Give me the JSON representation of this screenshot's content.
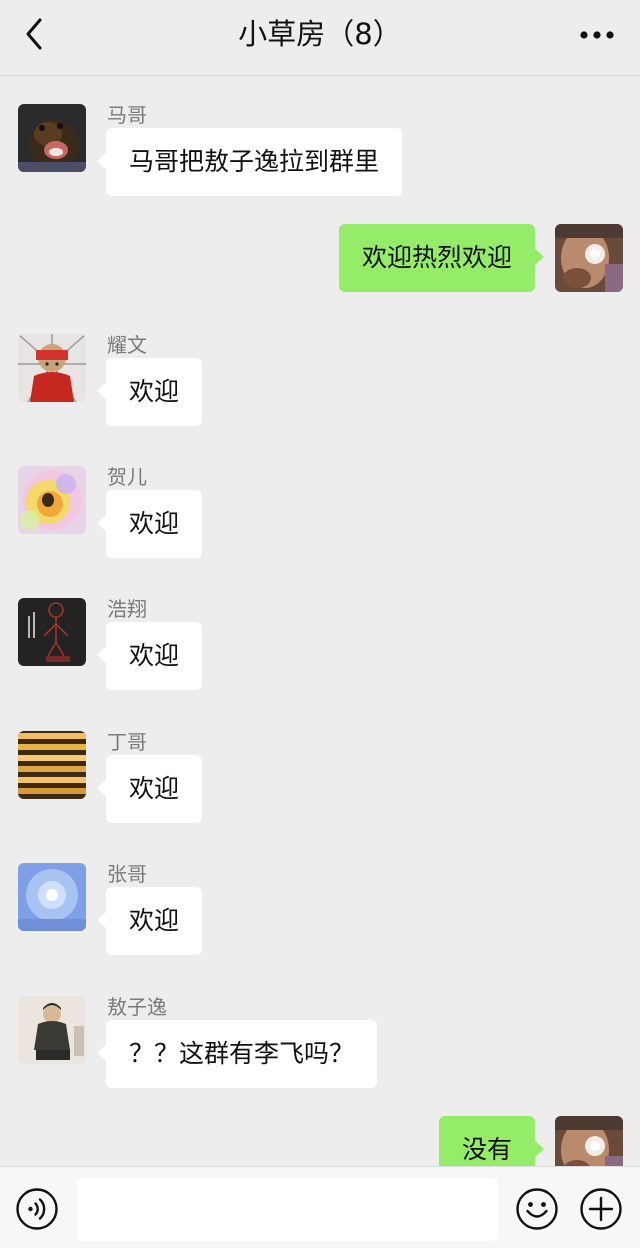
{
  "header": {
    "title": "小草房（8）",
    "back_icon": "chevron-left-icon",
    "more_icon": "more-horizontal-icon"
  },
  "messages": [
    {
      "side": "left",
      "sender": "马哥",
      "text": "马哥把敖子逸拉到群里"
    },
    {
      "side": "right",
      "sender": "",
      "text": "欢迎热烈欢迎"
    },
    {
      "side": "left",
      "sender": "耀文",
      "text": "欢迎"
    },
    {
      "side": "left",
      "sender": "贺儿",
      "text": "欢迎"
    },
    {
      "side": "left",
      "sender": "浩翔",
      "text": "欢迎"
    },
    {
      "side": "left",
      "sender": "丁哥",
      "text": "欢迎"
    },
    {
      "side": "left",
      "sender": "张哥",
      "text": "欢迎"
    },
    {
      "side": "left",
      "sender": "敖子逸",
      "text": "？？这群有李飞吗？"
    },
    {
      "side": "right",
      "sender": "",
      "text": "没有"
    }
  ],
  "input_bar": {
    "voice_icon": "voice-icon",
    "input_value": "",
    "emoji_icon": "emoji-icon",
    "plus_icon": "plus-icon"
  },
  "colors": {
    "background": "#ededed",
    "bubble_self": "#95ec69",
    "bubble_other": "#ffffff",
    "sender_name": "#7a7a7a"
  }
}
